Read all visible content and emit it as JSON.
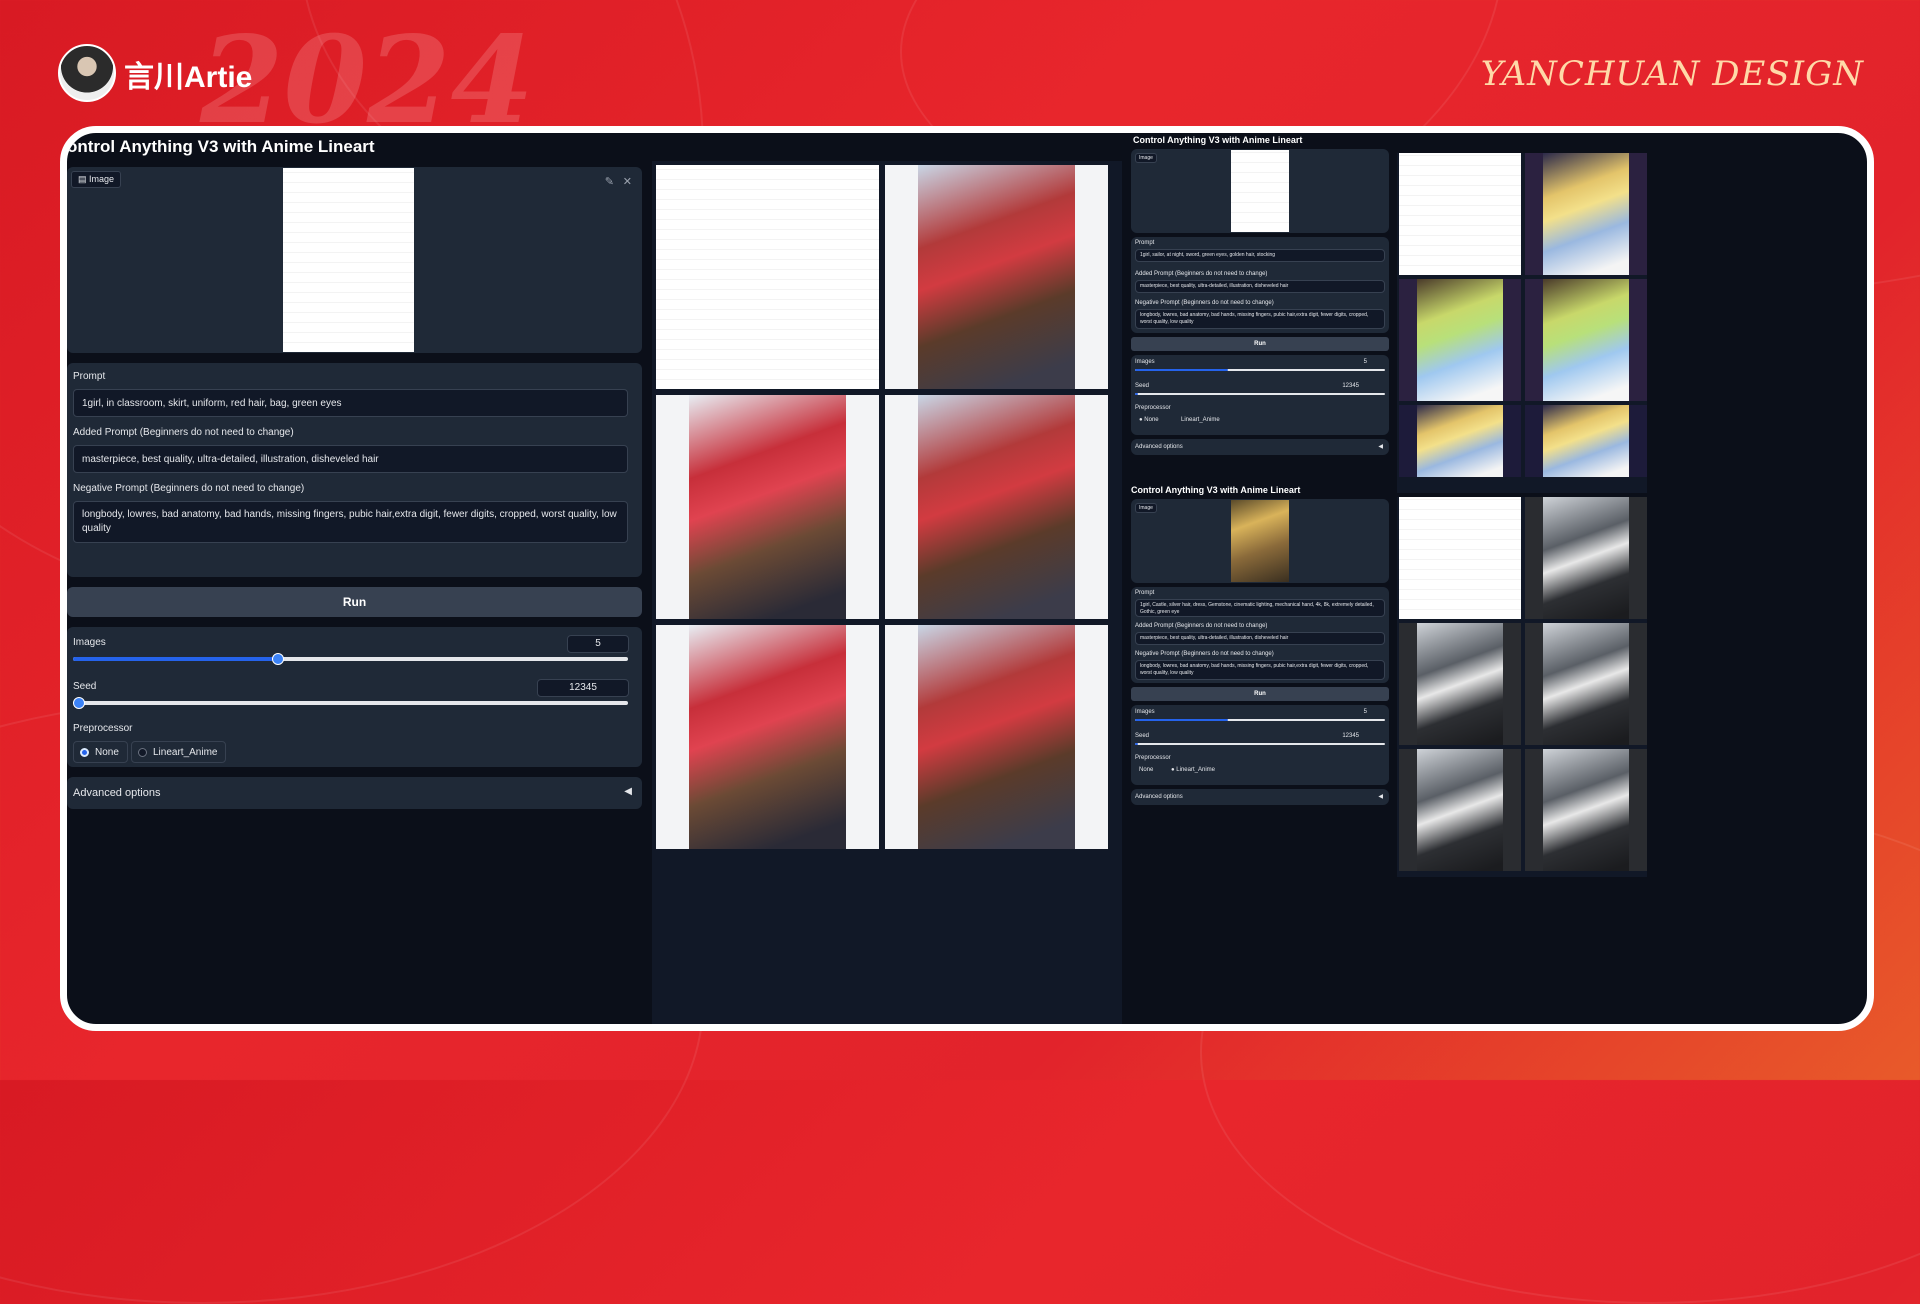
{
  "header": {
    "brand_name": "言川Artie",
    "brand_right": "YANCHUAN DESIGN",
    "bg_year": "2024"
  },
  "colors": {
    "background": "#e2232b",
    "panel": "#1f2937",
    "accent": "#2563eb",
    "frame": "#0b0f19"
  },
  "left_app": {
    "title": "ontrol Anything V3 with Anime Lineart",
    "image_label": "Image",
    "prompt_label": "Prompt",
    "prompt_value": "1girl, in classroom, skirt, uniform, red hair, bag, green eyes",
    "added_prompt_label": "Added Prompt (Beginners do not need to change)",
    "added_prompt_value": "masterpiece, best quality, ultra-detailed, illustration, disheveled hair",
    "negative_prompt_label": "Negative Prompt (Beginners do not need to change)",
    "negative_prompt_value": "longbody, lowres, bad anatomy, bad hands, missing fingers, pubic hair,extra digit, fewer digits, cropped, worst quality, low quality",
    "run_label": "Run",
    "images_label": "Images",
    "images_value": "5",
    "images_fraction": 0.37,
    "seed_label": "Seed",
    "seed_value": "12345",
    "seed_fraction": 0.01,
    "preprocessor_label": "Preprocessor",
    "preprocessor_options": [
      "None",
      "Lineart_Anime"
    ],
    "preprocessor_selected": "None",
    "advanced_label": "Advanced options",
    "advanced_icon": "triangle-left-icon"
  },
  "right_app_1": {
    "title": "Control Anything V3 with Anime Lineart",
    "image_label": "Image",
    "prompt_label": "Prompt",
    "prompt_value": "1girl, sailor, at night, sword, green eyes, golden hair, stocking",
    "added_prompt_label": "Added Prompt (Beginners do not need to change)",
    "added_prompt_value": "masterpiece, best quality, ultra-detailed, illustration, disheveled hair",
    "negative_prompt_label": "Negative Prompt (Beginners do not need to change)",
    "negative_prompt_value": "longbody, lowres, bad anatomy, bad hands, missing fingers, pubic hair,extra digit, fewer digits, cropped, worst quality, low quality",
    "run_label": "Run",
    "images_label": "Images",
    "images_value": "5",
    "images_fraction": 0.37,
    "seed_label": "Seed",
    "seed_value": "12345",
    "seed_fraction": 0.01,
    "preprocessor_label": "Preprocessor",
    "preprocessor_options": [
      "None",
      "Lineart_Anime"
    ],
    "preprocessor_selected": "None",
    "advanced_label": "Advanced options"
  },
  "right_app_2": {
    "title": "Control Anything V3 with Anime Lineart",
    "image_label": "Image",
    "prompt_label": "Prompt",
    "prompt_value": "1girl, Castle, silver hair, dress, Gemstone, cinematic lighting, mechanical hand, 4k, 8k, extremely detailed, Gothic, green eye",
    "added_prompt_label": "Added Prompt (Beginners do not need to change)",
    "added_prompt_value": "masterpiece, best quality, ultra-detailed, illustration, disheveled hair",
    "negative_prompt_label": "Negative Prompt (Beginners do not need to change)",
    "negative_prompt_value": "longbody, lowres, bad anatomy, bad hands, missing fingers, pubic hair,extra digit, fewer digits, cropped, worst quality, low quality",
    "run_label": "Run",
    "images_label": "Images",
    "images_value": "5",
    "images_fraction": 0.37,
    "seed_label": "Seed",
    "seed_value": "12345",
    "seed_fraction": 0.01,
    "preprocessor_label": "Preprocessor",
    "preprocessor_options": [
      "None",
      "Lineart_Anime"
    ],
    "preprocessor_selected": "Lineart_Anime",
    "advanced_label": "Advanced options"
  },
  "gallery_main": {
    "count": 6,
    "style": "red-hair-schoolgirl",
    "first_is_sketch": true
  },
  "gallery_right_1": {
    "count": 6,
    "style": "blonde-sailor-night",
    "first_is_sketch": true
  },
  "gallery_right_2": {
    "count": 6,
    "style": "silver-hair-gothic",
    "first_is_sketch": true
  }
}
